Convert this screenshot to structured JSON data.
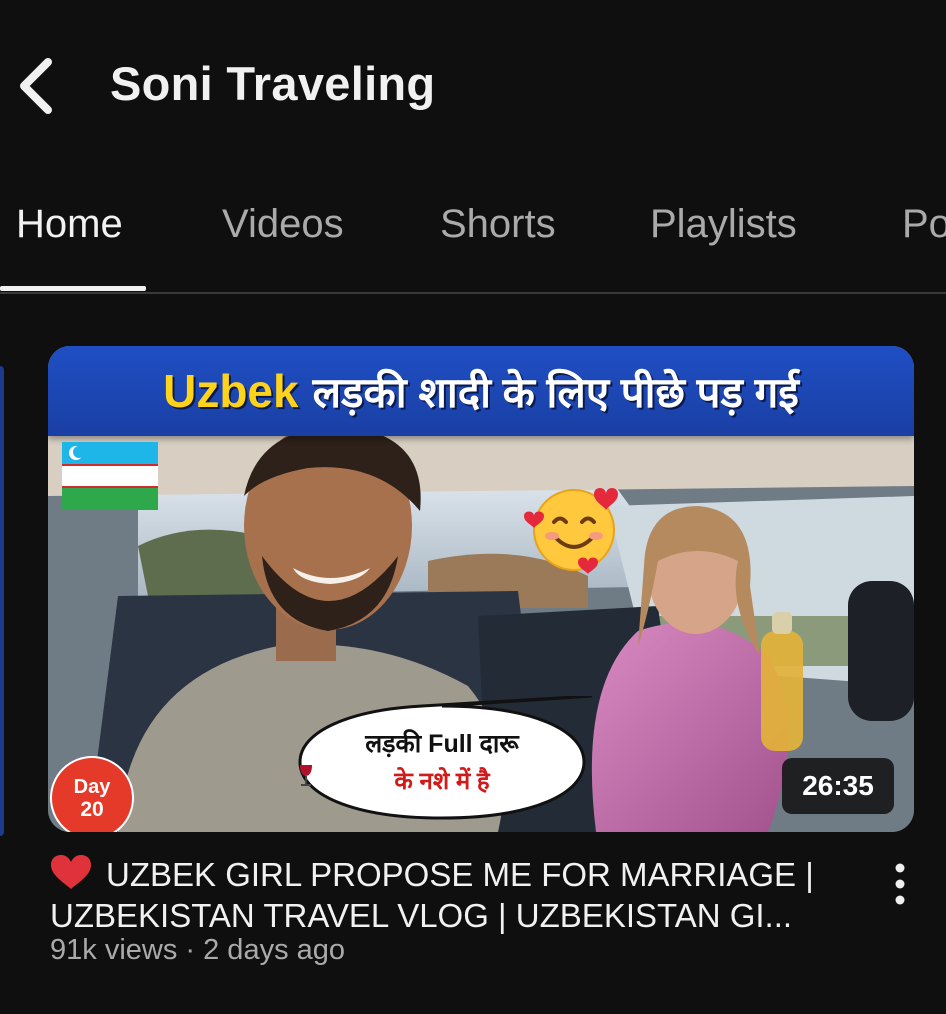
{
  "header": {
    "back_icon": "chevron-left-icon",
    "channel_name": "Soni Traveling"
  },
  "tabs": [
    {
      "label": "Home",
      "active": true
    },
    {
      "label": "Videos",
      "active": false
    },
    {
      "label": "Shorts",
      "active": false
    },
    {
      "label": "Playlists",
      "active": false
    },
    {
      "label": "Po",
      "active": false
    }
  ],
  "video": {
    "thumbnail": {
      "banner_en": "Uzbek",
      "banner_hi": "लड़की शादी के लिए पीछे पड़ गई",
      "bubble_line1": "लड़की Full दारू",
      "bubble_line2": "के नशे में है",
      "bubble_icon": "wine-glass-icon",
      "day_label": "Day",
      "day_number": "20",
      "sticker_icon": "smiling-face-with-hearts-icon",
      "flag_icon": "uzbekistan-flag-icon"
    },
    "duration": "26:35",
    "title_icon": "red-heart-icon",
    "title": "UZBEK GIRL PROPOSE ME FOR MARRIAGE | UZBEKISTAN TRAVEL VLOG | UZBEKISTAN GI...",
    "views": "91k views",
    "separator": "·",
    "age": "2 days ago",
    "menu_icon": "more-vertical-icon"
  },
  "colors": {
    "background": "#0f0f0f",
    "text_primary": "#f1f1f1",
    "text_secondary": "#aaaaaa",
    "banner_blue": "#1f4fc4",
    "banner_yellow": "#ffd31a",
    "badge_red": "#e53a2a",
    "heart_red": "#e0323a"
  }
}
